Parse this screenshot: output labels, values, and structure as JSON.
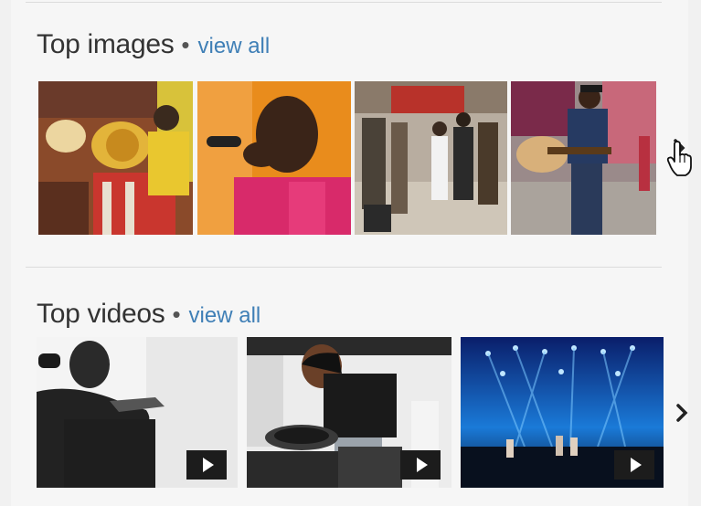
{
  "top_images": {
    "title": "Top images",
    "separator": "•",
    "view_all": "view all",
    "items": [
      {
        "icon": "brass-band-photo"
      },
      {
        "icon": "singer-with-microphone-photo"
      },
      {
        "icon": "street-crowd-photo"
      },
      {
        "icon": "street-guitarist-photo"
      }
    ],
    "next_icon": "chevron-right-icon",
    "cursor_icon": "hand-pointer-icon"
  },
  "top_videos": {
    "title": "Top videos",
    "separator": "•",
    "view_all": "view all",
    "items": [
      {
        "icon": "singer-bw-video-thumbnail"
      },
      {
        "icon": "dj-turntable-video-thumbnail"
      },
      {
        "icon": "concert-stage-video-thumbnail"
      }
    ],
    "play_icon": "play-icon",
    "next_icon": "chevron-right-icon"
  },
  "colors": {
    "link": "#3f7fb6",
    "heading": "#333333",
    "background": "#f6f6f6"
  }
}
